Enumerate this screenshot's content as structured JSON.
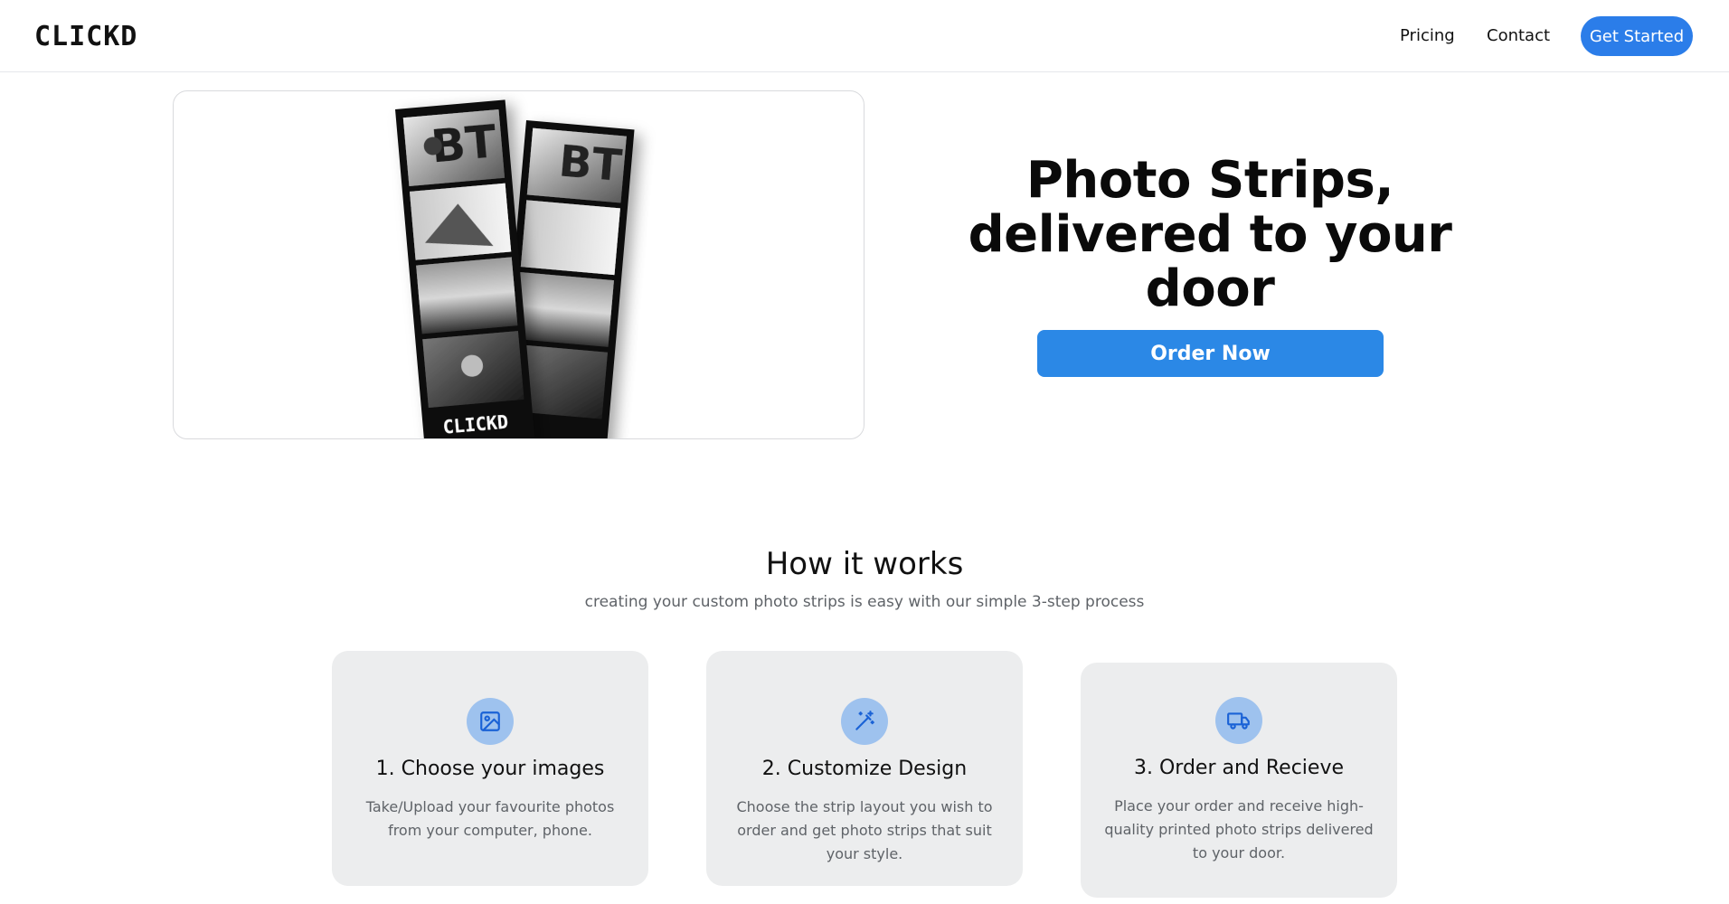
{
  "header": {
    "logo_text": "CLICKD",
    "nav": {
      "pricing": "Pricing",
      "contact": "Contact"
    },
    "cta": "Get Started"
  },
  "hero": {
    "image_icon": "photo-strips-image",
    "strip_text": "CLICKD",
    "title": "Photo Strips, delivered to your door",
    "cta": "Order Now"
  },
  "how": {
    "title": "How it works",
    "subtitle": "creating your custom photo strips is easy with our simple 3-step process",
    "steps": [
      {
        "icon": "image-icon",
        "title": "1. Choose your images",
        "desc": "Take/Upload your favourite photos from your computer, phone."
      },
      {
        "icon": "magic-wand-icon",
        "title": "2. Customize Design",
        "desc": "Choose the strip layout you wish to order and get photo strips that suit your style."
      },
      {
        "icon": "truck-icon",
        "title": "3. Order and Recieve",
        "desc": "Place your order and receive high-quality printed photo strips delivered to your door."
      }
    ]
  },
  "colors": {
    "accent": "#2b7de9",
    "card_bg": "#ecedee",
    "icon_bg": "#9ec2ee",
    "text_muted": "#5f6368"
  }
}
